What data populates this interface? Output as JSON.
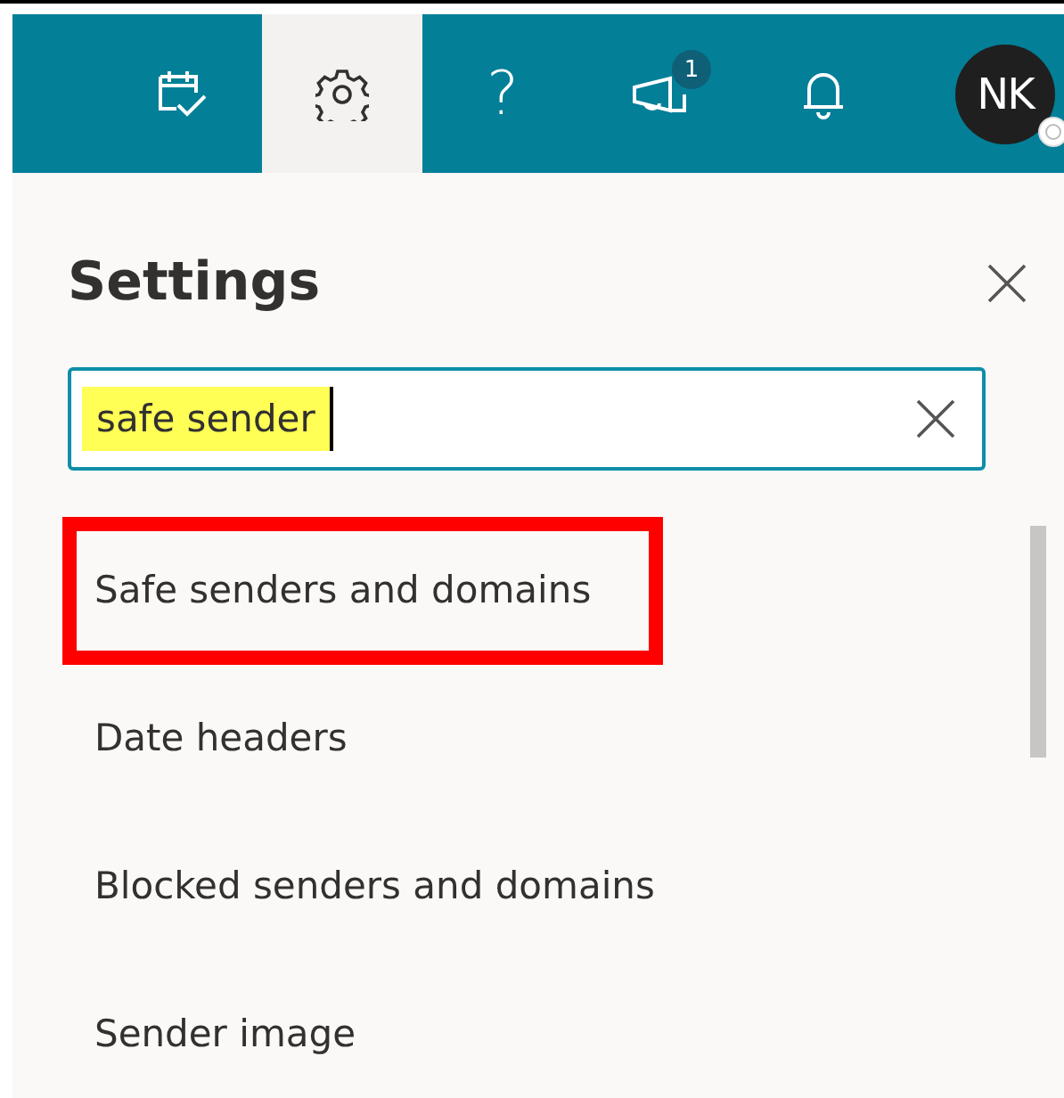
{
  "toolbar": [
    {
      "kind": "calendar",
      "selected": false
    },
    {
      "kind": "settings",
      "selected": true
    },
    {
      "kind": "help",
      "label": "?",
      "selected": false
    },
    {
      "kind": "megaphone",
      "badge": "1",
      "selected": false
    },
    {
      "kind": "bell",
      "selected": false
    },
    {
      "kind": "avatar",
      "label": "NK",
      "selected": false
    }
  ],
  "panel": {
    "title": "Settings",
    "search": {
      "value": "safe sender",
      "highlighted": true
    },
    "results": [
      {
        "label": "Safe senders and domains",
        "outlined": true
      },
      {
        "label": "Date headers",
        "outlined": false
      },
      {
        "label": "Blocked senders and domains",
        "outlined": false
      },
      {
        "label": "Sender image",
        "outlined": false
      }
    ]
  }
}
